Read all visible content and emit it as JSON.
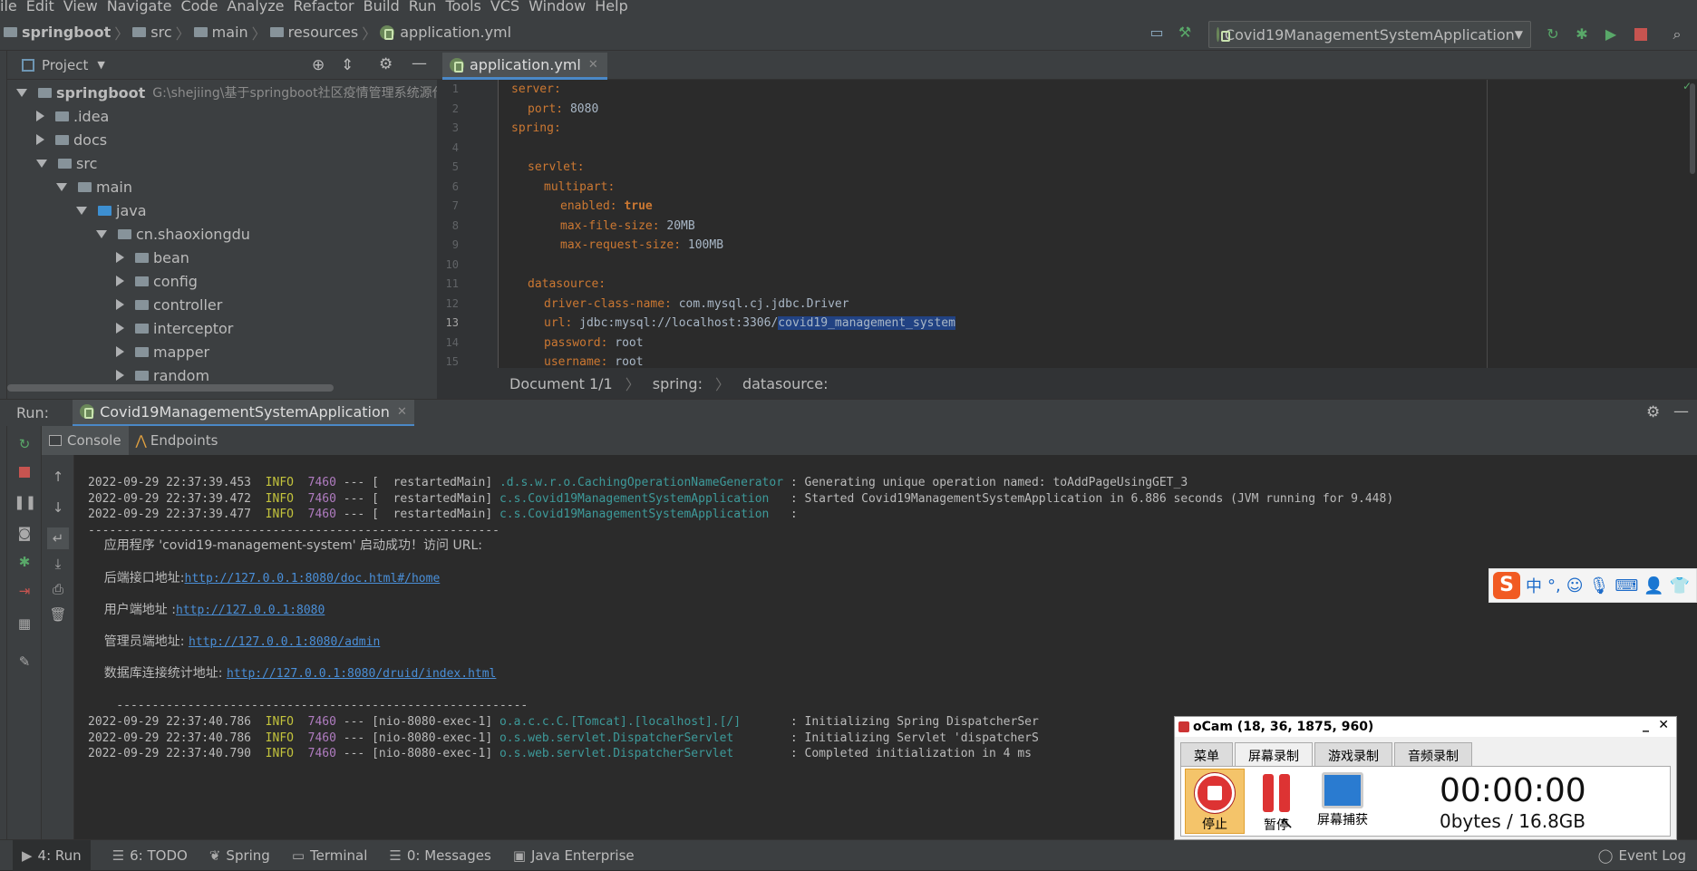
{
  "menubar": [
    "ile",
    "Edit",
    "View",
    "Navigate",
    "Code",
    "Analyze",
    "Refactor",
    "Build",
    "Run",
    "Tools",
    "VCS",
    "Window",
    "Help"
  ],
  "breadcrumbs": [
    "springboot",
    "src",
    "main",
    "resources",
    "application.yml"
  ],
  "run_config": "Covid19ManagementSystemApplication",
  "project": {
    "title": "Project",
    "tree": [
      {
        "label": "springboot",
        "path": "G:\\shejiing\\基于springboot社区疫情管理系统源代",
        "state": "down",
        "depth": 0
      },
      {
        "label": ".idea",
        "state": "right",
        "depth": 1
      },
      {
        "label": "docs",
        "state": "right",
        "depth": 1
      },
      {
        "label": "src",
        "state": "down",
        "depth": 1
      },
      {
        "label": "main",
        "state": "down",
        "depth": 2
      },
      {
        "label": "java",
        "state": "down",
        "depth": 3
      },
      {
        "label": "cn.shaoxiongdu",
        "state": "down",
        "depth": 4
      },
      {
        "label": "bean",
        "state": "right",
        "depth": 5
      },
      {
        "label": "config",
        "state": "right",
        "depth": 5
      },
      {
        "label": "controller",
        "state": "right",
        "depth": 5
      },
      {
        "label": "interceptor",
        "state": "right",
        "depth": 5
      },
      {
        "label": "mapper",
        "state": "right",
        "depth": 5
      },
      {
        "label": "random",
        "state": "right",
        "depth": 5
      }
    ]
  },
  "editor": {
    "tab": "application.yml",
    "lines": [
      {
        "n": "1",
        "key": "server:",
        "val": "",
        "indent": 0
      },
      {
        "n": "2",
        "key": "port:",
        "val": " 8080",
        "indent": 1
      },
      {
        "n": "3",
        "key": "spring:",
        "val": "",
        "indent": 0
      },
      {
        "n": "4",
        "key": "",
        "val": "",
        "indent": 0
      },
      {
        "n": "5",
        "key": "servlet:",
        "val": "",
        "indent": 1
      },
      {
        "n": "6",
        "key": "multipart:",
        "val": "",
        "indent": 2
      },
      {
        "n": "7",
        "key": "enabled:",
        "val": " true",
        "indent": 3,
        "bold": true
      },
      {
        "n": "8",
        "key": "max-file-size:",
        "val": " 20MB",
        "indent": 3
      },
      {
        "n": "9",
        "key": "max-request-size:",
        "val": " 100MB",
        "indent": 3
      },
      {
        "n": "10",
        "key": "",
        "val": "",
        "indent": 0
      },
      {
        "n": "11",
        "key": "datasource:",
        "val": "",
        "indent": 1
      },
      {
        "n": "12",
        "key": "driver-class-name:",
        "val": " com.mysql.cj.jdbc.Driver",
        "indent": 2
      },
      {
        "n": "13",
        "key": "url:",
        "val": " jdbc:mysql://localhost:3306/",
        "sel": "covid19_management_system",
        "indent": 2
      },
      {
        "n": "14",
        "key": "password:",
        "val": " root",
        "indent": 2
      },
      {
        "n": "15",
        "key": "username:",
        "val": " root",
        "indent": 2
      }
    ],
    "breadcrumb": [
      "Document 1/1",
      "spring:",
      "datasource:"
    ]
  },
  "run": {
    "label": "Run:",
    "tab": "Covid19ManagementSystemApplication",
    "console_tab": "Console",
    "endpoints_tab": "Endpoints"
  },
  "console": [
    {
      "t": "log",
      "ts": "2022-09-29 22:37:39.453",
      "lvl": "INFO",
      "pid": "7460",
      "thr": " --- [  restartedMain] ",
      "cls": ".d.s.w.r.o.CachingOperationNameGenerator",
      "msg": " : Generating unique operation named: toAddPageUsingGET_3"
    },
    {
      "t": "log",
      "ts": "2022-09-29 22:37:39.472",
      "lvl": "INFO",
      "pid": "7460",
      "thr": " --- [  restartedMain] ",
      "cls": "c.s.Covid19ManagementSystemApplication  ",
      "msg": " : Started Covid19ManagementSystemApplication in 6.886 seconds (JVM running for 9.448)"
    },
    {
      "t": "log",
      "ts": "2022-09-29 22:37:39.477",
      "lvl": "INFO",
      "pid": "7460",
      "thr": " --- [  restartedMain] ",
      "cls": "c.s.Covid19ManagementSystemApplication  ",
      "msg": " :"
    },
    {
      "t": "text",
      "text": "----------------------------------------------------------"
    },
    {
      "t": "cn",
      "text": "    应用程序 'covid19-management-system' 启动成功！访问 URL:"
    },
    {
      "t": "blank"
    },
    {
      "t": "url",
      "label": "    后端接口地址:",
      "url": "http://127.0.0.1:8080/doc.html#/home"
    },
    {
      "t": "blank"
    },
    {
      "t": "url",
      "label": "    用户端地址 :",
      "url": "http://127.0.0.1:8080"
    },
    {
      "t": "blank"
    },
    {
      "t": "url",
      "label": "    管理员端地址: ",
      "url": "http://127.0.0.1:8080/admin"
    },
    {
      "t": "blank"
    },
    {
      "t": "url",
      "label": "    数据库连接统计地址: ",
      "url": "http://127.0.0.1:8080/druid/index.html"
    },
    {
      "t": "blank"
    },
    {
      "t": "text",
      "text": "    ----------------------------------------------------------"
    },
    {
      "t": "log",
      "ts": "2022-09-29 22:37:40.786",
      "lvl": "INFO",
      "pid": "7460",
      "thr": " --- [nio-8080-exec-1] ",
      "cls": "o.a.c.c.C.[Tomcat].[localhost].[/]      ",
      "msg": " : Initializing Spring DispatcherSer"
    },
    {
      "t": "log",
      "ts": "2022-09-29 22:37:40.786",
      "lvl": "INFO",
      "pid": "7460",
      "thr": " --- [nio-8080-exec-1] ",
      "cls": "o.s.web.servlet.DispatcherServlet       ",
      "msg": " : Initializing Servlet 'dispatcherS"
    },
    {
      "t": "log",
      "ts": "2022-09-29 22:37:40.790",
      "lvl": "INFO",
      "pid": "7460",
      "thr": " --- [nio-8080-exec-1] ",
      "cls": "o.s.web.servlet.DispatcherServlet       ",
      "msg": " : Completed initialization in 4 ms"
    }
  ],
  "statusbar": {
    "run": "4: Run",
    "todo": "6: TODO",
    "spring": "Spring",
    "terminal": "Terminal",
    "messages": "0: Messages",
    "javaee": "Java Enterprise",
    "eventlog": "Event Log"
  },
  "ime": {
    "logo": "S",
    "mode": "中",
    "punct": "°,"
  },
  "ocam": {
    "title": "oCam (18, 36, 1875, 960)",
    "tabs": [
      "菜单",
      "屏幕录制",
      "游戏录制",
      "音频录制"
    ],
    "active_tab": 1,
    "stop": "停止",
    "pause": "暂停",
    "capture": "屏幕捕获",
    "time": "00:00:00",
    "size": "0bytes / 16.8GB"
  }
}
